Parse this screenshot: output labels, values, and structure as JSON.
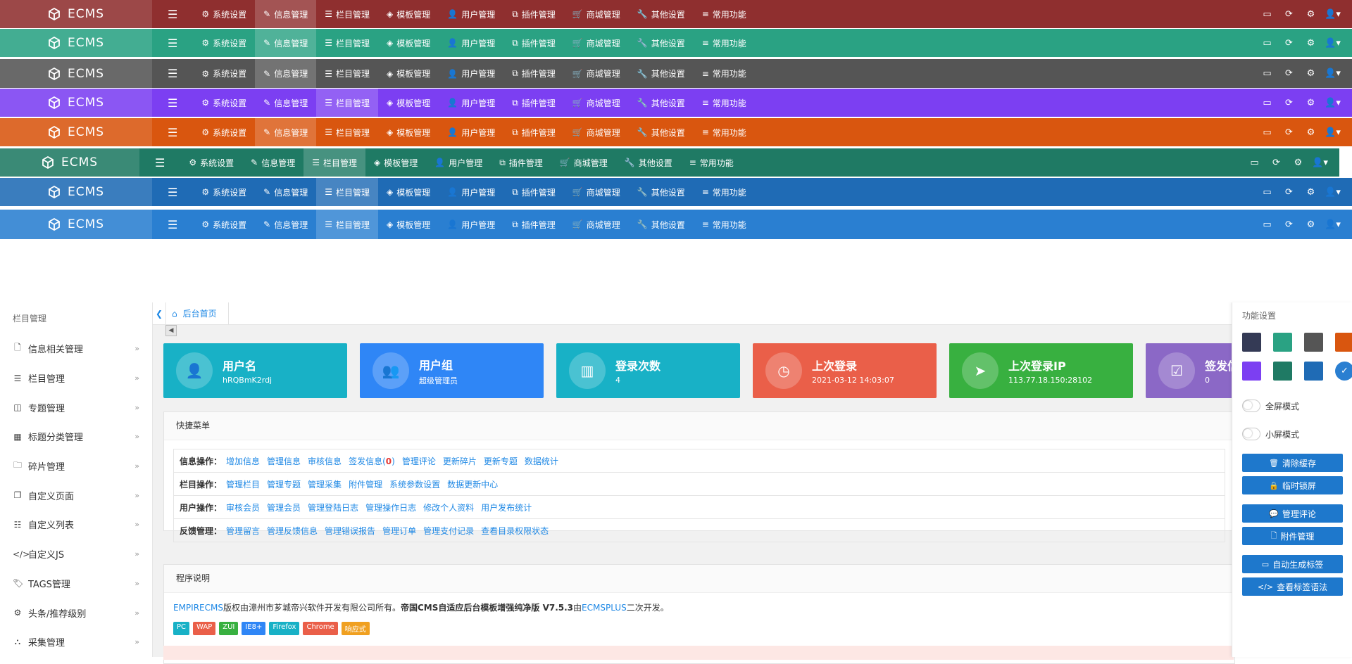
{
  "app": {
    "logo_text": "ECMS"
  },
  "nav": {
    "items": [
      "系统设置",
      "信息管理",
      "栏目管理",
      "模板管理",
      "用户管理",
      "插件管理",
      "商城管理",
      "其他设置",
      "常用功能"
    ],
    "icons": [
      "gear-icon",
      "edit-icon",
      "list-icon",
      "layers-icon",
      "user-icon",
      "plugin-icon",
      "cart-icon",
      "wrench-icon",
      "sliders-icon"
    ]
  },
  "themes": [
    {
      "color": "#8f2f2f"
    },
    {
      "color": "#2aa283"
    },
    {
      "color": "#555555"
    },
    {
      "color": "#7c3ff2"
    },
    {
      "color": "#d9560f"
    },
    {
      "color": "#1f7a64"
    },
    {
      "color": "#1f6bb5"
    },
    {
      "color": "#2a7fd1"
    }
  ],
  "sidebar": {
    "title": "栏目管理",
    "items": [
      {
        "label": "信息相关管理",
        "icon": "file-icon"
      },
      {
        "label": "栏目管理",
        "icon": "list-icon"
      },
      {
        "label": "专题管理",
        "icon": "columns-icon"
      },
      {
        "label": "标题分类管理",
        "icon": "grid-icon"
      },
      {
        "label": "碎片管理",
        "icon": "folder-icon"
      },
      {
        "label": "自定义页面",
        "icon": "copy-icon"
      },
      {
        "label": "自定义列表",
        "icon": "list-ul-icon"
      },
      {
        "label": "自定义JS",
        "icon": "code-icon"
      },
      {
        "label": "TAGS管理",
        "icon": "tag-icon"
      },
      {
        "label": "头条/推荐级别",
        "icon": "gear-icon"
      },
      {
        "label": "采集管理",
        "icon": "sitemap-icon"
      }
    ]
  },
  "breadcrumb": {
    "home": "后台首页"
  },
  "stats": [
    {
      "title": "用户名",
      "value": "hRQBmK2rdj",
      "color": "#18b1c6",
      "icon": "user-icon"
    },
    {
      "title": "用户组",
      "value": "超级管理员",
      "color": "#2f86f6",
      "icon": "users-icon"
    },
    {
      "title": "登录次数",
      "value": "4",
      "color": "#18b1c6",
      "icon": "chart-icon"
    },
    {
      "title": "上次登录",
      "value": "2021-03-12 14:03:07",
      "color": "#ea5f49",
      "icon": "clock-icon"
    },
    {
      "title": "上次登录IP",
      "value": "113.77.18.150:28102",
      "color": "#38b040",
      "icon": "send-icon"
    },
    {
      "title": "签发信",
      "value": "0",
      "color": "#8b68c6",
      "icon": "check-icon"
    }
  ],
  "quick": {
    "title": "快捷菜单",
    "rows": [
      {
        "key": "信息操作：",
        "links": [
          "增加信息",
          "管理信息",
          "审核信息",
          "签发信息",
          "管理评论",
          "更新碎片",
          "更新专题",
          "数据统计"
        ],
        "count": "0"
      },
      {
        "key": "栏目操作：",
        "links": [
          "管理栏目",
          "管理专题",
          "管理采集",
          "附件管理",
          "系统参数设置",
          "数据更新中心"
        ]
      },
      {
        "key": "用户操作：",
        "links": [
          "审核会员",
          "管理会员",
          "管理登陆日志",
          "管理操作日志",
          "修改个人资料",
          "用户发布统计"
        ]
      },
      {
        "key": "反馈管理：",
        "links": [
          "管理留言",
          "管理反馈信息",
          "管理错误报告",
          "管理订单",
          "管理支付记录",
          "查看目录权限状态"
        ]
      }
    ]
  },
  "program": {
    "title": "程序说明",
    "brand1": "EMPIRECMS",
    "text1": "版权由漳州市芗城帝兴软件开发有限公司所有。",
    "text2": "帝国CMS自适应后台模板增强纯净版 V7.5.3",
    "text3": "由",
    "brand2": "ECMSPLUS",
    "text4": "二次开发。",
    "badges": [
      {
        "label": "PC",
        "color": "#18b1c6"
      },
      {
        "label": "WAP",
        "color": "#ea5f49"
      },
      {
        "label": "ZUI",
        "color": "#38b040"
      },
      {
        "label": "IE8+",
        "color": "#2f86f6"
      },
      {
        "label": "Firefox",
        "color": "#18b1c6"
      },
      {
        "label": "Chrome",
        "color": "#ea5f49"
      },
      {
        "label": "响应式",
        "color": "#f0a020"
      }
    ]
  },
  "rightpanel": {
    "title": "功能设置",
    "swatches": [
      "#343a55",
      "#2aa283",
      "#555555",
      "#d9560f",
      "#7c3ff2",
      "#1f7a64",
      "#1f6bb5",
      "#2a7fd1"
    ],
    "toggles": [
      "全屏模式",
      "小屏模式"
    ],
    "buttons": [
      {
        "label": "清除缓存",
        "icon": "trash-icon"
      },
      {
        "label": "临时锁屏",
        "icon": "lock-icon"
      },
      {
        "label": "管理评论",
        "icon": "comment-icon"
      },
      {
        "label": "附件管理",
        "icon": "file-icon"
      },
      {
        "label": "自动生成标签",
        "icon": "window-icon"
      },
      {
        "label": "查看标签语法",
        "icon": "code-icon"
      }
    ]
  }
}
